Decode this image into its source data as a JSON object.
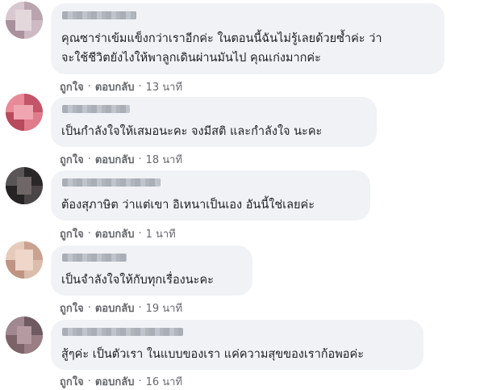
{
  "comments": [
    {
      "text_lines": [
        "คุณซาร่าเข้มแข็งกว่าเราอีกค่ะ ในตอนนี้ฉันไม่รู้เลยด้วยซ้ำค่ะ ว่า",
        "จะใช้ชีวิตยังไงให้พาลูกเดินผ่านมันไป คุณเก่งมากค่ะ"
      ],
      "like": "ถูกใจ",
      "reply": "ตอบกลับ",
      "time": "13 นาที"
    },
    {
      "text_lines": [
        "เป็นกำลังใจให้เสมอนะคะ จงมีสติ และกำลังใจ นะคะ"
      ],
      "like": "ถูกใจ",
      "reply": "ตอบกลับ",
      "time": "18 นาที"
    },
    {
      "text_lines": [
        "ต้องสุภาษิต ว่าแต่เขา อิเหนาเป็นเอง อันนี้ใช่เลยค่ะ"
      ],
      "like": "ถูกใจ",
      "reply": "ตอบกลับ",
      "time": "1 นาที"
    },
    {
      "text_lines": [
        "เป็นจำลังใจให้กับทุกเรื่องนะคะ"
      ],
      "like": "ถูกใจ",
      "reply": "ตอบกลับ",
      "time": "19 นาที"
    },
    {
      "text_lines": [
        "สู้ๆค่ะ เป็นตัวเรา ในแบบของเรา แค่ความสุขของเราก้อพอค่ะ"
      ],
      "like": "ถูกใจ",
      "reply": "ตอบกลับ",
      "time": "16 นาที"
    }
  ],
  "separator": "·",
  "colors": {
    "bubble": "#f0f2f5",
    "text": "#1c1e21",
    "meta": "#65676b"
  }
}
